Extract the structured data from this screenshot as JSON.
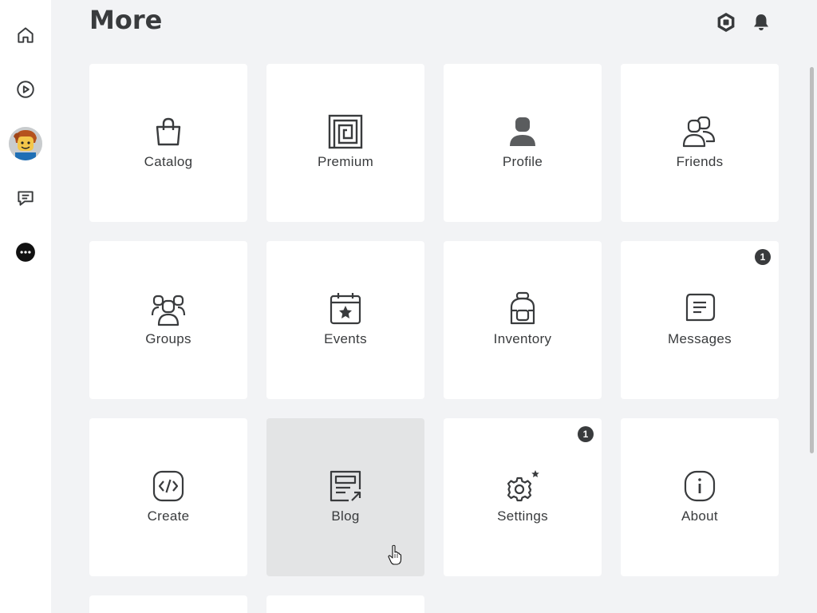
{
  "header": {
    "title": "More"
  },
  "sidebar": {
    "items": [
      {
        "name": "home",
        "icon": "home-icon"
      },
      {
        "name": "discover",
        "icon": "play-icon"
      },
      {
        "name": "avatar",
        "icon": "avatar"
      },
      {
        "name": "chat",
        "icon": "chat-icon"
      },
      {
        "name": "more",
        "icon": "more-icon"
      }
    ]
  },
  "topbar": {
    "icons": [
      "robux-icon",
      "bell-icon"
    ]
  },
  "tiles": [
    {
      "label": "Catalog",
      "icon": "bag-icon"
    },
    {
      "label": "Premium",
      "icon": "premium-icon"
    },
    {
      "label": "Profile",
      "icon": "person-icon"
    },
    {
      "label": "Friends",
      "icon": "friends-icon"
    },
    {
      "label": "Groups",
      "icon": "groups-icon"
    },
    {
      "label": "Events",
      "icon": "calendar-star-icon"
    },
    {
      "label": "Inventory",
      "icon": "backpack-icon"
    },
    {
      "label": "Messages",
      "icon": "message-icon",
      "badge": "1"
    },
    {
      "label": "Create",
      "icon": "code-icon"
    },
    {
      "label": "Blog",
      "icon": "blog-icon"
    },
    {
      "label": "Settings",
      "icon": "gear-icon",
      "badge": "1"
    },
    {
      "label": "About",
      "icon": "info-icon"
    }
  ],
  "colors": {
    "page_bg": "#f2f3f5",
    "tile_bg": "#ffffff",
    "tile_hover": "#e3e4e5",
    "text": "#393b3d",
    "badge": "#393b3d"
  }
}
